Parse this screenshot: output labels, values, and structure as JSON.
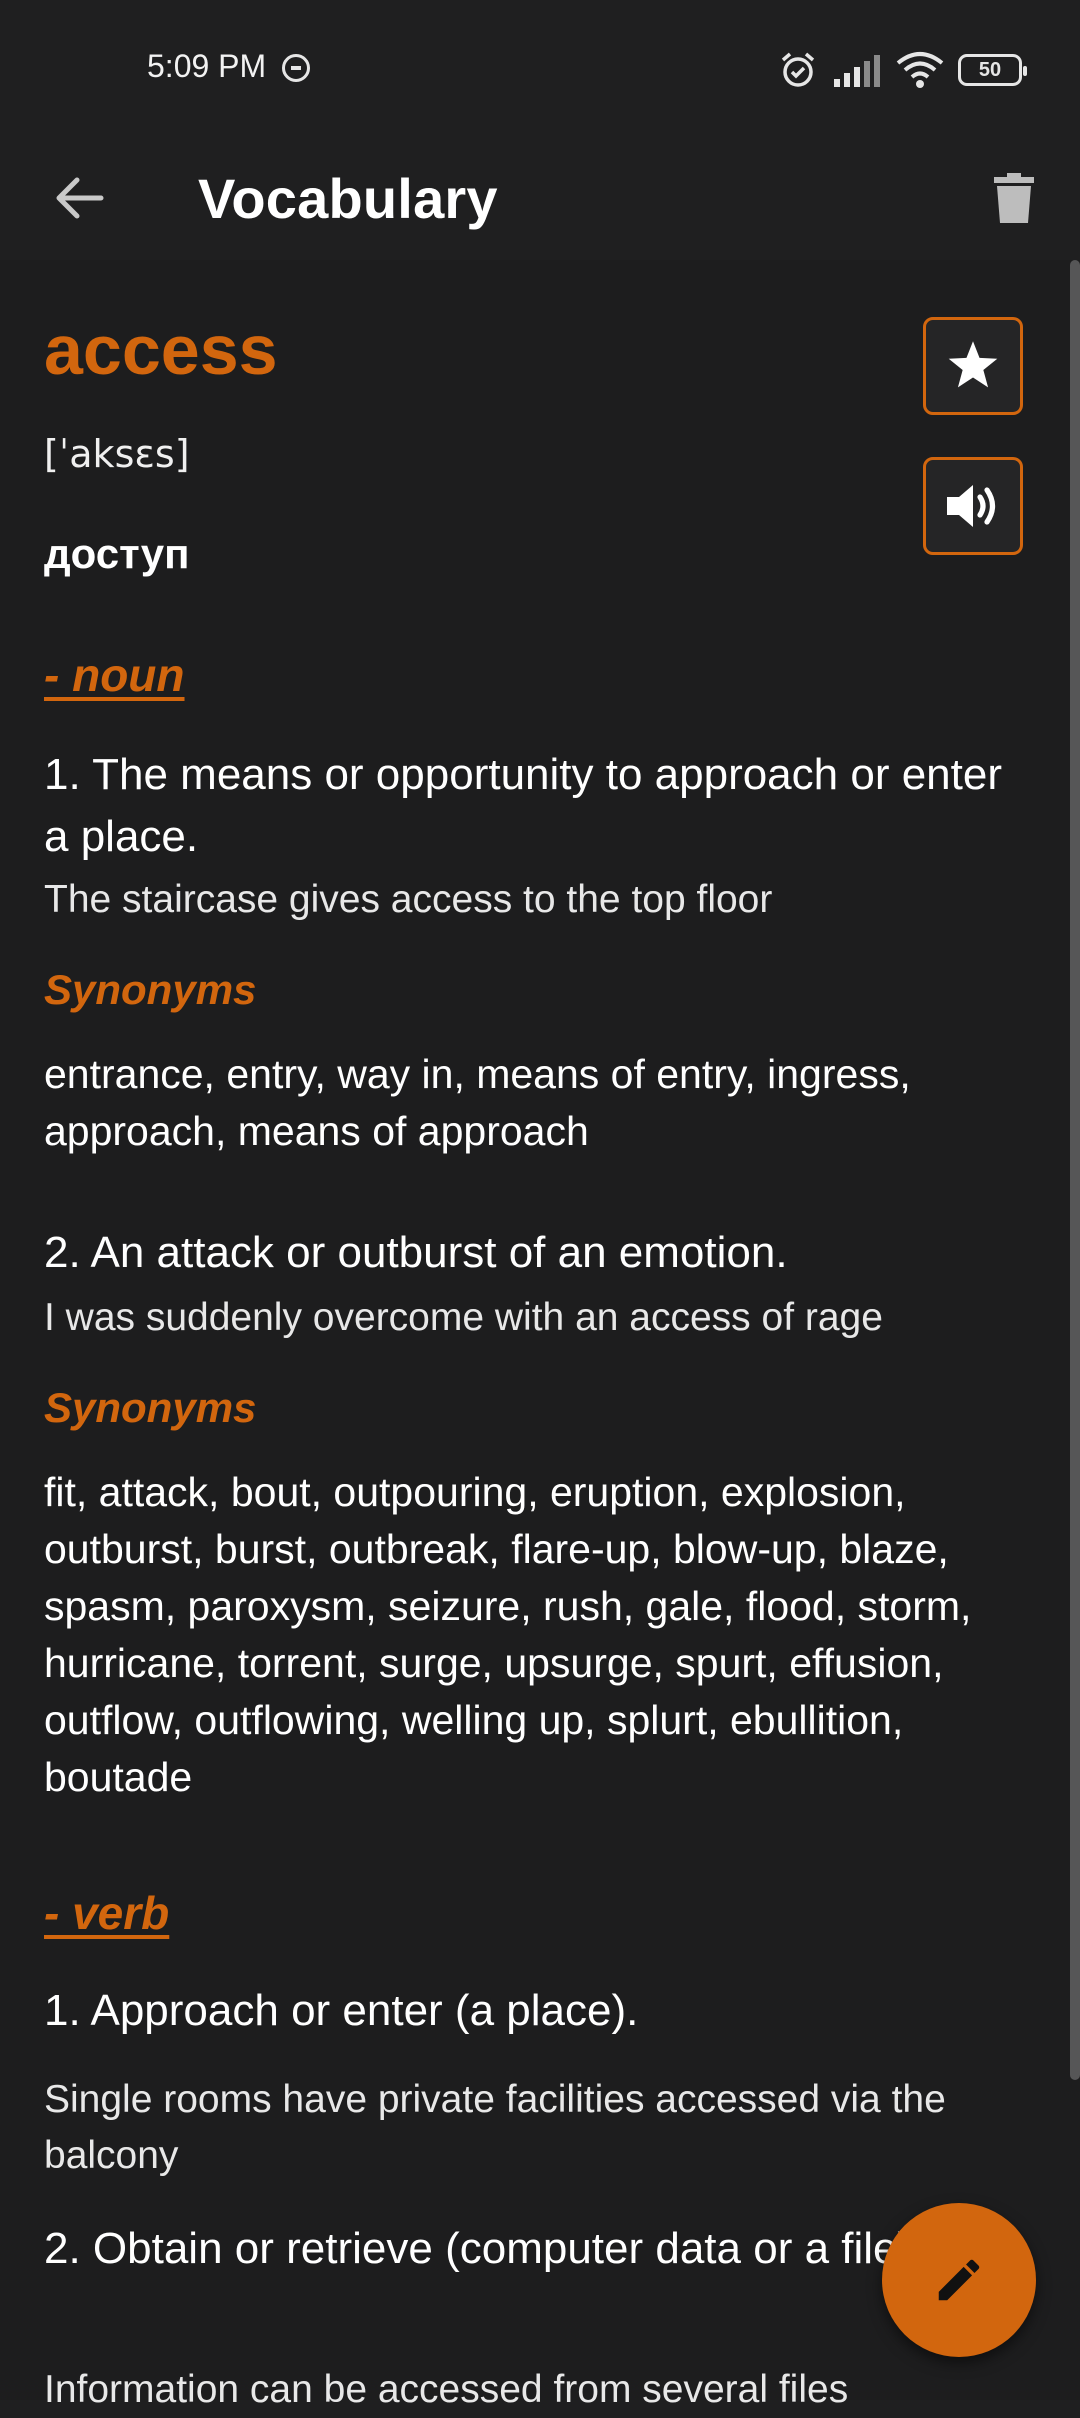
{
  "status_bar": {
    "time": "5:09 PM",
    "battery": "50",
    "icons": [
      "dnd-icon",
      "alarm-icon",
      "signal-icon",
      "wifi-icon",
      "battery-icon"
    ]
  },
  "app_bar": {
    "title": "Vocabulary",
    "back_icon": "arrow-back-icon",
    "delete_icon": "trash-icon"
  },
  "entry": {
    "word": "access",
    "phonetic": "[ˈaksɛs]",
    "translation": "доступ",
    "favorite_icon": "star-icon",
    "audio_icon": "speaker-icon"
  },
  "noun": {
    "label": "- noun",
    "def1": "1. The means or opportunity to approach or enter a place.",
    "ex1": "The staircase gives access to the top floor",
    "syn_label1": "Synonyms",
    "syn1": "entrance, entry, way in, means of entry, ingress, approach, means of approach",
    "def2": "2. An attack or outburst of an emotion.",
    "ex2": "I was suddenly overcome with an access of rage",
    "syn_label2": "Synonyms",
    "syn2": "fit, attack, bout, outpouring, eruption, explosion, outburst, burst, outbreak, flare-up, blow-up, blaze, spasm, paroxysm, seizure, rush, gale, flood, storm, hurricane, torrent, surge, upsurge, spurt, effusion, outflow, outflowing, welling up, splurt, ebullition, boutade"
  },
  "verb": {
    "label": "- verb",
    "def1": "1. Approach or enter (a place).",
    "ex1": "Single rooms have private facilities accessed via the balcony",
    "def2": "2. Obtain or retrieve (computer data or a file).",
    "ex2": "Information can be accessed from several files"
  },
  "fab": {
    "icon": "pencil-icon"
  },
  "colors": {
    "accent": "#d2660e",
    "background": "#1d1d1e",
    "text": "#ffffff"
  }
}
